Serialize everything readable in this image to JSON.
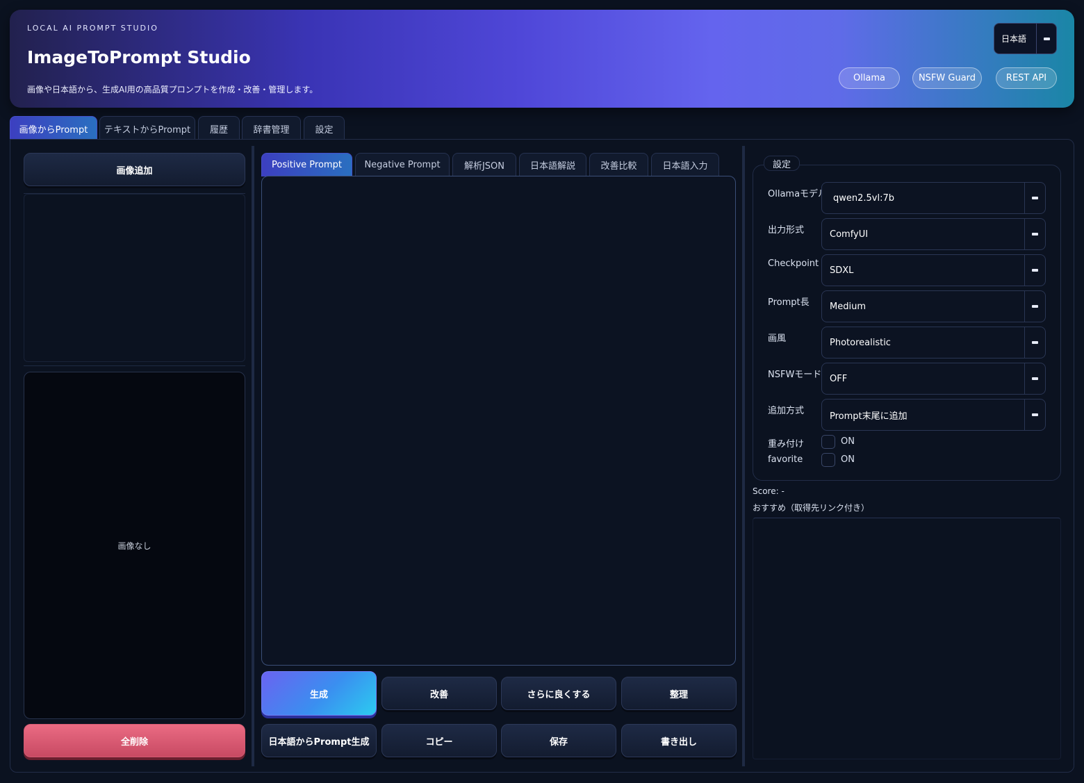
{
  "header": {
    "eyebrow": "LOCAL AI PROMPT STUDIO",
    "title": "ImageToPrompt Studio",
    "subtitle": "画像や日本語から、生成AI用の高品質プロンプトを作成・改善・管理します。",
    "language": "日本語",
    "pills": [
      "Ollama",
      "NSFW Guard",
      "REST API"
    ]
  },
  "main_tabs": [
    "画像からPrompt",
    "テキストからPrompt",
    "履歴",
    "辞書管理",
    "設定"
  ],
  "left": {
    "add_image": "画像追加",
    "no_image": "画像なし",
    "delete_all": "全削除"
  },
  "center": {
    "tabs": [
      "Positive Prompt",
      "Negative Prompt",
      "解析JSON",
      "日本語解説",
      "改善比較",
      "日本語入力"
    ],
    "prompt_value": "",
    "actions_row1": [
      "生成",
      "改善",
      "さらに良くする",
      "整理"
    ],
    "actions_row2": [
      "日本語からPrompt生成",
      "コピー",
      "保存",
      "書き出し"
    ]
  },
  "settings": {
    "legend": "設定",
    "fields": [
      {
        "label": "Ollamaモデル",
        "value": "qwen2.5vl:7b"
      },
      {
        "label": "出力形式",
        "value": "ComfyUI"
      },
      {
        "label": "Checkpoint",
        "value": "SDXL"
      },
      {
        "label": "Prompt長",
        "value": "Medium"
      },
      {
        "label": "画風",
        "value": "Photorealistic"
      },
      {
        "label": "NSFWモード",
        "value": "OFF"
      },
      {
        "label": "追加方式",
        "value": "Prompt末尾に追加"
      }
    ],
    "checks": [
      {
        "label": "重み付け",
        "option": "ON",
        "checked": false
      },
      {
        "label": "favorite",
        "option": "ON",
        "checked": false
      }
    ]
  },
  "score": "Score: -",
  "recommend_label": "おすすめ（取得先リンク付き）",
  "colors": {
    "accent": "#4f47d8",
    "danger": "#e0607a",
    "background": "#0b1220"
  }
}
